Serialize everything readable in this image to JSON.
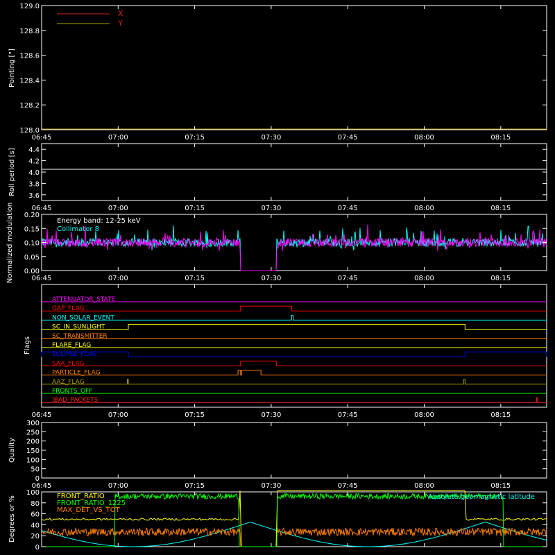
{
  "x_tick_labels": [
    "06:45",
    "07:00",
    "07:15",
    "07:30",
    "07:45",
    "08:00",
    "08:15"
  ],
  "colors": {
    "background": "#000000",
    "axes": "#ffffff",
    "magenta": "#ff00ff",
    "cyan": "#00ffff",
    "red": "#ff0000",
    "orange": "#ff8000",
    "yellow": "#ffff00",
    "blue": "#0000ff",
    "olive": "#b0a000",
    "green": "#00ff00",
    "bright_red": "#ff2020"
  },
  "chart_data": [
    {
      "type": "line",
      "ylabel": "Pointing [\"]",
      "ylim": [
        128.0,
        129.0
      ],
      "y_ticks": [
        "128.0",
        "128.2",
        "128.4",
        "128.6",
        "128.8",
        "129.0"
      ],
      "legend": "top-left",
      "series": [
        {
          "name": "X",
          "color": "#d02020",
          "values": []
        },
        {
          "name": "Y",
          "color": "#b0a000",
          "values": []
        }
      ]
    },
    {
      "type": "line",
      "ylabel": "Roll period [s]",
      "ylim": [
        3.5,
        4.5
      ],
      "y_ticks": [
        "3.6",
        "3.8",
        "4.0",
        "4.2",
        "4.4"
      ],
      "series": [
        {
          "color": "#ffffff",
          "x": [
            "06:45",
            "08:24"
          ],
          "y": [
            4.0,
            4.0
          ]
        }
      ]
    },
    {
      "type": "line",
      "ylabel": "Normalized modulation",
      "ylim": [
        0.0,
        0.2
      ],
      "y_ticks": [
        "0.00",
        "0.05",
        "0.10",
        "0.15",
        "0.20"
      ],
      "annotations": [
        "Energy band: 12-25 keV",
        "Collimator 8"
      ],
      "gap": [
        "07:24",
        "07:31"
      ],
      "series": [
        {
          "color": "#00ffff",
          "mean": 0.1
        },
        {
          "color": "#ff00ff",
          "mean": 0.1
        }
      ]
    },
    {
      "type": "line",
      "ylabel": "Flags",
      "flags": [
        {
          "name": "ATTENUATOR_STATE",
          "color": "#ff00ff",
          "high": []
        },
        {
          "name": "GAP_FLAG",
          "color": "#ff0000",
          "high": [
            [
              "07:24",
              "07:34"
            ]
          ]
        },
        {
          "name": "NON_SOLAR_EVENT",
          "color": "#00ffff",
          "high": [
            [
              "07:34",
              "07:34.3"
            ]
          ]
        },
        {
          "name": "SC_IN_SUNLIGHT",
          "color": "#ffff00",
          "high": [
            [
              "07:02",
              "08:08"
            ]
          ]
        },
        {
          "name": "SC_TRANSMITTER",
          "color": "#ff8000",
          "high": []
        },
        {
          "name": "FLARE_FLAG",
          "color": "#ffff00",
          "high": []
        },
        {
          "name": "ECLIPSE_FLAG",
          "color": "#0000ff",
          "high": [
            [
              "06:45",
              "07:02"
            ],
            [
              "08:08",
              "08:24"
            ]
          ]
        },
        {
          "name": "SAA_FLAG",
          "color": "#ff0000",
          "high": [
            [
              "07:24",
              "07:31"
            ]
          ]
        },
        {
          "name": "PARTICLE_FLAG",
          "color": "#ff8000",
          "high": [
            [
              "07:23.5",
              "07:24"
            ],
            [
              "07:24.2",
              "07:28"
            ]
          ]
        },
        {
          "name": "AAZ_FLAG",
          "color": "#b0a000",
          "high": [
            [
              "07:01.8",
              "07:02"
            ],
            [
              "08:07.7",
              "08:08"
            ]
          ]
        },
        {
          "name": "FRONTS_OFF",
          "color": "#00ff00",
          "high": []
        },
        {
          "name": "IBAD_PACKETS",
          "color": "#ff2020",
          "high": [
            [
              "08:22",
              "08:22.2"
            ]
          ]
        }
      ]
    },
    {
      "type": "line",
      "ylabel": "Quality",
      "ylim": [
        0,
        300
      ],
      "y_ticks": [
        "0",
        "50",
        "100",
        "150",
        "200",
        "250",
        "300"
      ],
      "series": []
    },
    {
      "type": "line",
      "ylabel": "Degrees or %",
      "ylim": [
        0,
        100
      ],
      "y_ticks": [
        "0",
        "20",
        "40",
        "60",
        "80",
        "100"
      ],
      "annotations": [
        "Absolute geomagnetic latitude"
      ],
      "series": [
        {
          "name": "FRONT_RATIO",
          "color": "#ffff00"
        },
        {
          "name": "FRONT_RATIO_1225",
          "color": "#00ff00"
        },
        {
          "name": "MAX_DET_VS_TOT",
          "color": "#ff8000"
        }
      ]
    }
  ]
}
